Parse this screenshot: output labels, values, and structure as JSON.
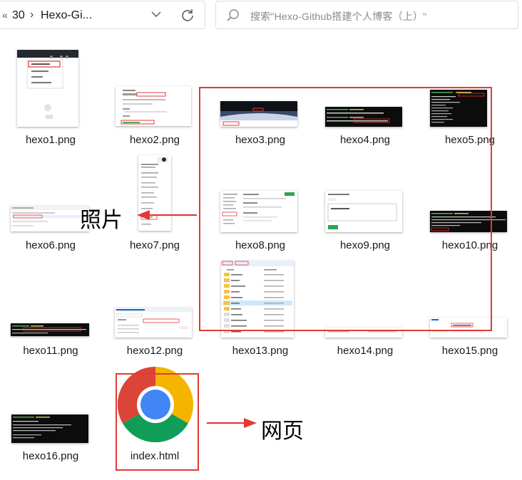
{
  "toolbar": {
    "back_sep": "«",
    "breadcrumb": [
      "30",
      "Hexo-Gi..."
    ],
    "crumb_sep": "›",
    "search_placeholder": "搜索\"Hexo-Github搭建个人博客（上）\""
  },
  "files": [
    {
      "name": "hexo1.png"
    },
    {
      "name": "hexo2.png"
    },
    {
      "name": "hexo3.png"
    },
    {
      "name": "hexo4.png"
    },
    {
      "name": "hexo5.png"
    },
    {
      "name": "hexo6.png"
    },
    {
      "name": "hexo7.png"
    },
    {
      "name": "hexo8.png"
    },
    {
      "name": "hexo9.png"
    },
    {
      "name": "hexo10.png"
    },
    {
      "name": "hexo11.png"
    },
    {
      "name": "hexo12.png"
    },
    {
      "name": "hexo13.png"
    },
    {
      "name": "hexo14.png"
    },
    {
      "name": "hexo15.png"
    },
    {
      "name": "hexo16.png"
    },
    {
      "name": "index.html"
    }
  ],
  "annotations": {
    "photos_label": "照片",
    "webpage_label": "网页"
  },
  "colors": {
    "annotation": "#e53935",
    "chrome_red": "#db4437",
    "chrome_green": "#0f9d58",
    "chrome_yellow": "#f4b400",
    "chrome_blue": "#4285f4"
  },
  "icons": [
    "chevron-down-icon",
    "refresh-icon",
    "search-icon",
    "chrome-icon",
    "arrow-left-icon",
    "arrow-right-icon"
  ]
}
